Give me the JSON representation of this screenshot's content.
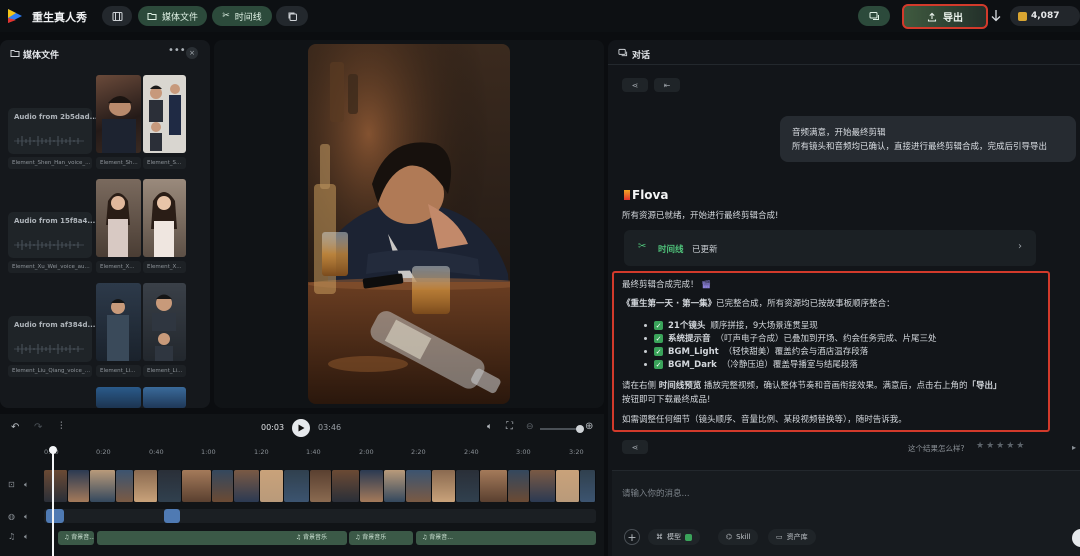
{
  "app": {
    "title": "重生真人秀"
  },
  "toolbar": {
    "media_label": "媒体文件",
    "timeline_label": "时间线",
    "export_label": "导出",
    "credits": "4,087",
    "colors": {
      "accent_green": "#2c4a3b",
      "highlight_red": "#d23a2b"
    }
  },
  "media_panel": {
    "title": "媒体文件",
    "audio_items": [
      {
        "title": "Audio from 2b5dad...",
        "label": "Element_Shen_Han_voice_..."
      },
      {
        "title": "Audio from 15f8a4...",
        "label": "Element_Xu_Wei_voice_au..."
      },
      {
        "title": "Audio from af384d...",
        "label": "Element_Liu_Qiang_voice_s..."
      }
    ],
    "image_labels": [
      [
        "Element_Sh...",
        "Element_S..."
      ],
      [
        "Element_X...",
        "Element_X..."
      ],
      [
        "Element_Li...",
        "Element_Li..."
      ]
    ]
  },
  "timeline": {
    "current_time": "00:03",
    "total_time": "03:46",
    "ticks": [
      "0:00",
      "0:20",
      "0:40",
      "1:00",
      "1:20",
      "1:40",
      "2:00",
      "2:20",
      "2:40",
      "3:00",
      "3:20"
    ],
    "audio_clips": [
      {
        "label": "♫ 背景音..."
      },
      {
        "label": "♫ 背景音乐"
      },
      {
        "label": "♫ 背景音乐"
      },
      {
        "label": "♫ 背景音..."
      }
    ]
  },
  "chat": {
    "title": "对话",
    "user_message": {
      "line1": "音频满意，开始最终剪辑",
      "line2": "所有镜头和音频均已确认，直接进行最终剪辑合成，完成后引导导出"
    },
    "assistant_name": "Flova",
    "assistant_intro": "所有资源已就绪，开始进行最终剪辑合成!",
    "timeline_card": {
      "name": "时间线",
      "status": "已更新"
    },
    "final_message": {
      "heading": "最终剪辑合成完成！",
      "summary_title": "《重生第一天 · 第一集》",
      "summary_rest": "已完整合成，所有资源均已按故事板顺序整合：",
      "bullets": [
        {
          "bold": "21个镜头",
          "text": "顺序拼接，9大场景连贯呈现"
        },
        {
          "bold": "系统提示音",
          "text": "（叮声电子合成）已叠加到开场、约会任务完成、片尾三处"
        },
        {
          "bold": "BGM_Light",
          "text": "（轻快甜美）覆盖约会与酒店温存段落"
        },
        {
          "bold": "BGM_Dark",
          "text": "（冷静压迫）覆盖导播室与结尾段落"
        }
      ],
      "para_a": "请在右侧",
      "para_bold": "时间线预览",
      "para_b": "播放完整视频，确认整体节奏和音画衔接效果。满意后，点击右上角的",
      "para_export": "「导出」",
      "para_c": "按钮即可下载最终成品!",
      "closing": "如需调整任何细节（镜头顺序、音量比例、某段视频替换等），随时告诉我。"
    },
    "rating_prompt": "这个结果怎么样?",
    "input_placeholder": "请输入你的消息...",
    "chips": {
      "model": "模型",
      "skill": "Skill",
      "assets": "资产库"
    }
  }
}
